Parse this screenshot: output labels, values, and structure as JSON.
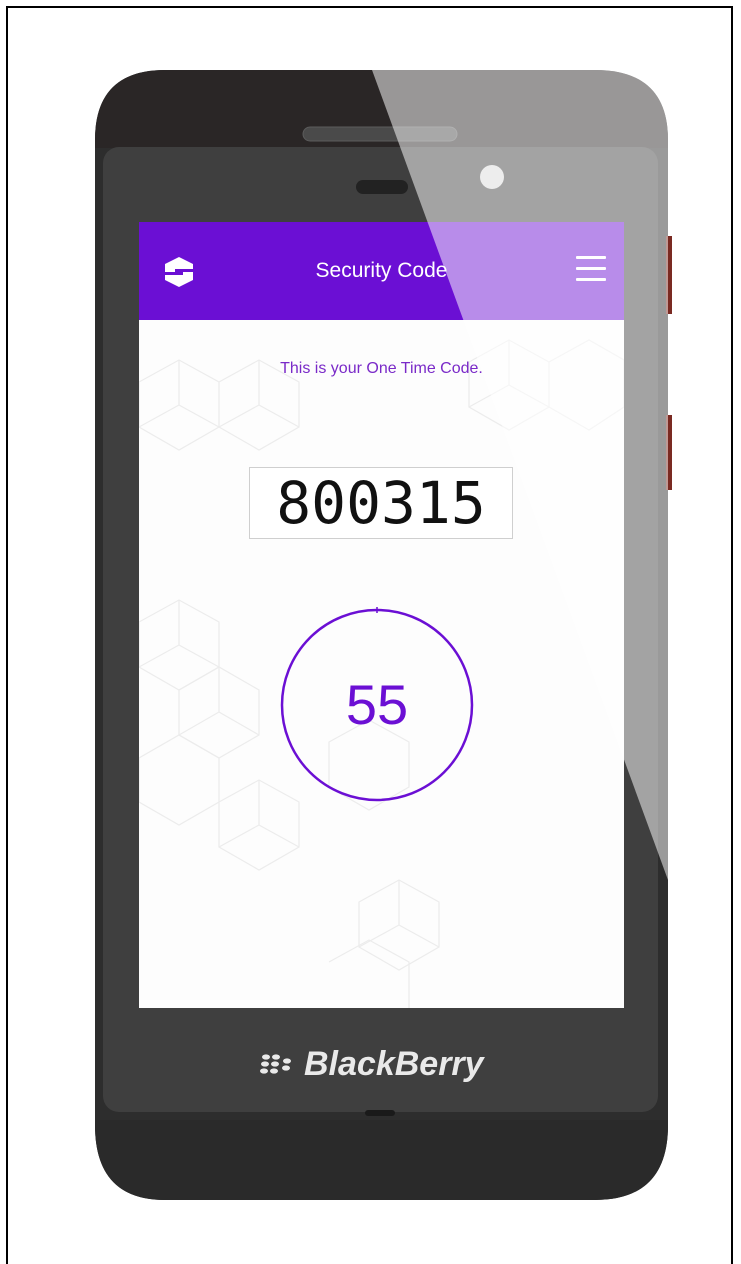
{
  "app": {
    "title": "Security Code",
    "subtitle": "This is your One Time Code.",
    "code": "800315",
    "timer_seconds": "55"
  },
  "device": {
    "brand": "BlackBerry"
  },
  "icons": {
    "app_logo": "shield-s-icon",
    "menu": "hamburger-menu-icon",
    "brand_logo": "blackberry-logo-icon"
  },
  "colors": {
    "accent": "#6b0fd4",
    "phone_body": "#3a3a3a",
    "screen_bg": "#fdfdfd"
  },
  "timer_progress": 0.92
}
